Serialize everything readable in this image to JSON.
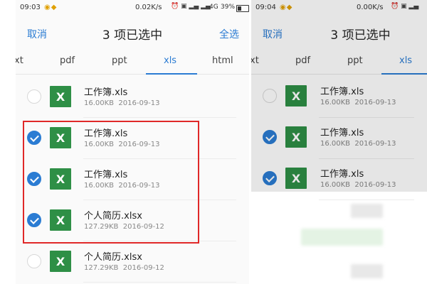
{
  "left": {
    "status": {
      "time": "09:03",
      "speed": "0.02K/s",
      "net": "4G",
      "battery": "39%"
    },
    "header": {
      "cancel": "取消",
      "title": "3 项已选中",
      "select_all": "全选"
    },
    "tabs": [
      "xt",
      "pdf",
      "ppt",
      "xls",
      "html"
    ],
    "active_tab": "xls",
    "files": [
      {
        "name": "工作簿.xls",
        "size": "16.00KB",
        "date": "2016-09-13",
        "checked": false
      },
      {
        "name": "工作簿.xls",
        "size": "16.00KB",
        "date": "2016-09-13",
        "checked": true
      },
      {
        "name": "工作簿.xls",
        "size": "16.00KB",
        "date": "2016-09-13",
        "checked": true
      },
      {
        "name": "个人简历.xlsx",
        "size": "127.29KB",
        "date": "2016-09-12",
        "checked": true
      },
      {
        "name": "个人简历.xlsx",
        "size": "127.29KB",
        "date": "2016-09-12",
        "checked": false
      }
    ]
  },
  "right": {
    "status": {
      "time": "09:04",
      "speed": "0.00K/s"
    },
    "header": {
      "cancel": "取消",
      "title": "3 项已选中"
    },
    "tabs": [
      "xt",
      "pdf",
      "ppt",
      "xls"
    ],
    "active_tab": "xls",
    "files": [
      {
        "name": "工作簿.xls",
        "size": "16.00KB",
        "date": "2016-09-13",
        "checked": false
      },
      {
        "name": "工作簿.xls",
        "size": "16.00KB",
        "date": "2016-09-13",
        "checked": true
      },
      {
        "name": "工作簿.xls",
        "size": "16.00KB",
        "date": "2016-09-13",
        "checked": true
      }
    ]
  },
  "icons": {
    "file": "excel-file-icon",
    "check": "checkmark-circle-icon"
  },
  "colors": {
    "accent": "#2b7cd3",
    "excel": "#2e8f46",
    "highlight": "#e02828"
  }
}
